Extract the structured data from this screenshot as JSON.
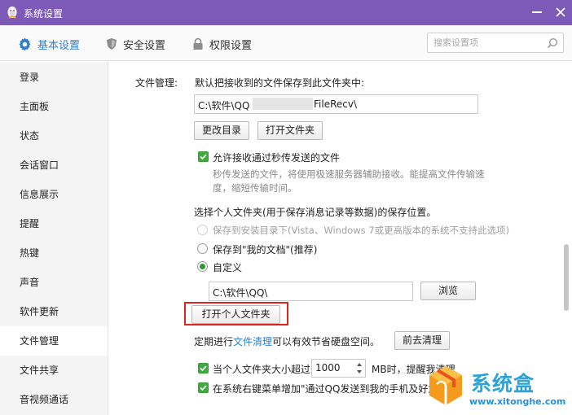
{
  "window": {
    "title": "系统设置"
  },
  "topnav": {
    "tabs": [
      {
        "label": "基本设置",
        "icon": "gear-icon"
      },
      {
        "label": "安全设置",
        "icon": "shield-icon"
      },
      {
        "label": "权限设置",
        "icon": "lock-icon"
      }
    ],
    "search_placeholder": "搜索设置项"
  },
  "sidebar": {
    "items": [
      {
        "label": "登录"
      },
      {
        "label": "主面板"
      },
      {
        "label": "状态"
      },
      {
        "label": "会话窗口"
      },
      {
        "label": "信息展示"
      },
      {
        "label": "提醒"
      },
      {
        "label": "热键"
      },
      {
        "label": "声音"
      },
      {
        "label": "软件更新"
      },
      {
        "label": "文件管理"
      },
      {
        "label": "文件共享"
      },
      {
        "label": "音视频通话"
      }
    ],
    "active": "文件管理"
  },
  "file_mgmt": {
    "section_label": "文件管理:",
    "recv_desc": "默认把接收到的文件保存到此文件夹中:",
    "recv_path_left": "C:\\软件\\QQ",
    "recv_path_right": "FileRecv\\",
    "change_dir_btn": "更改目录",
    "open_folder_btn": "打开文件夹",
    "flash_checkbox_label": "允许接收通过秒传发送的文件",
    "flash_desc_line1": "秒传发送的文件，将使用极速服务器辅助接收。能提高文件传输速",
    "flash_desc_line2": "度，缩短传输时间。",
    "personal_folder_desc": "选择个人文件夹(用于保存消息记录等数据)的保存位置。",
    "radio_install_dir": "保存到安装目录下(Vista、Windows 7或更高版本的系统不支持此选项)",
    "radio_my_docs": "保存到\"我的文档\"(推荐)",
    "radio_custom": "自定义",
    "custom_path": "C:\\软件\\QQ\\",
    "browse_btn": "浏览",
    "open_personal_btn": "打开个人文件夹",
    "cleanup_prefix": "定期进行",
    "cleanup_link": "文件清理",
    "cleanup_suffix": "可以有效节省硬盘空间。",
    "goto_cleanup_btn": "前去清理",
    "size_check_prefix": "当个人文件夹大小超过",
    "size_value": "1000",
    "size_suffix": "MB时，提醒我清理",
    "context_menu_label": "在系统右键菜单增加\"通过QQ发送到我的手机及好友\""
  },
  "watermark": {
    "brand": "系统盒",
    "url": "www.xitonghe.com"
  },
  "colors": {
    "titlebar": "#7d5ab8",
    "accent": "#2f7fd0",
    "highlight_box": "#e0231d",
    "checkbox": "#3faa3f"
  }
}
